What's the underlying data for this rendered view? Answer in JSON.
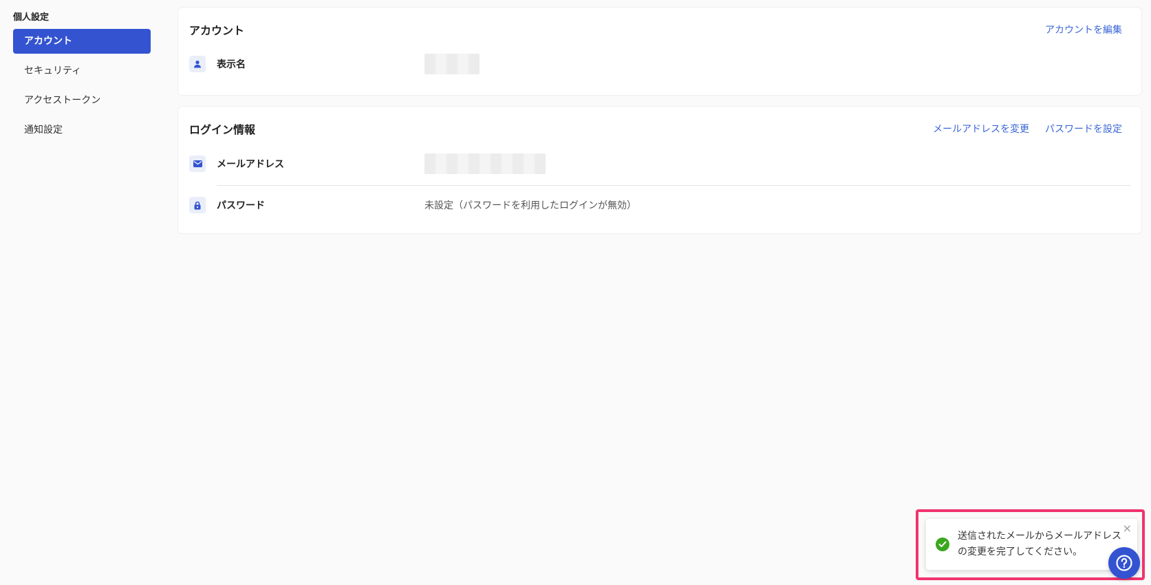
{
  "sidebar": {
    "title": "個人設定",
    "items": [
      {
        "label": "アカウント",
        "active": true
      },
      {
        "label": "セキュリティ",
        "active": false
      },
      {
        "label": "アクセストークン",
        "active": false
      },
      {
        "label": "通知設定",
        "active": false
      }
    ]
  },
  "account_card": {
    "title": "アカウント",
    "edit_link": "アカウントを編集",
    "display_name_label": "表示名",
    "display_name_icon": "person-icon"
  },
  "login_card": {
    "title": "ログイン情報",
    "change_email_link": "メールアドレスを変更",
    "set_password_link": "パスワードを設定",
    "email_label": "メールアドレス",
    "email_icon": "mail-icon",
    "password_label": "パスワード",
    "password_icon": "lock-icon",
    "password_value": "未設定（パスワードを利用したログインが無効）"
  },
  "toast": {
    "message_line1": "送信されたメールからメールアドレス",
    "message_line2": "の変更を完了してください。",
    "close_label": "×",
    "status": "success"
  },
  "colors": {
    "accent": "#3353d1",
    "link": "#3a66d6",
    "success": "#3aa81e",
    "highlight": "#f0346e"
  }
}
